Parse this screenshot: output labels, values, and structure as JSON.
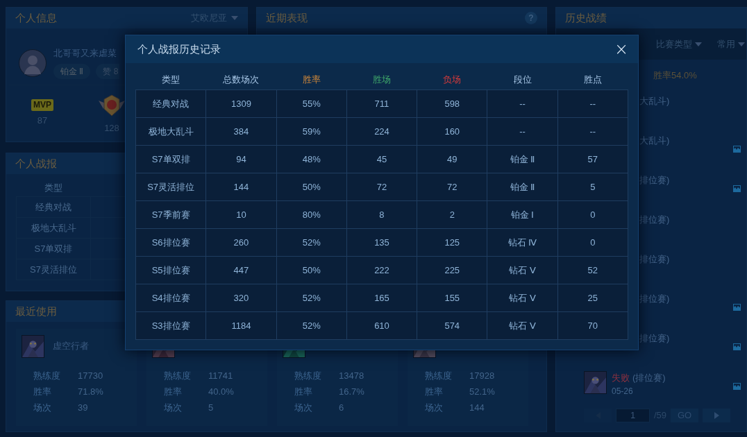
{
  "profile_panel": {
    "title": "个人信息",
    "server": "艾欧尼亚",
    "player_name": "北哥哥又来虐菜",
    "rank": "铂金 Ⅱ",
    "likes": "赞 8",
    "badges": [
      {
        "kind": "mvp",
        "label": "MVP",
        "count": "87"
      },
      {
        "kind": "medal",
        "count": "128"
      }
    ]
  },
  "stats_panel": {
    "title": "个人战报",
    "columns": [
      "类型"
    ],
    "rows": [
      [
        "经典对战"
      ],
      [
        "极地大乱斗"
      ],
      [
        "S7单双排"
      ],
      [
        "S7灵活排位"
      ]
    ]
  },
  "performance_panel": {
    "title": "近期表现",
    "help": "?"
  },
  "recent_panel": {
    "title": "最近使用",
    "heroes": [
      {
        "name": "虚空行者",
        "stats": [
          {
            "label": "熟练度",
            "value": "17730"
          },
          {
            "label": "胜率",
            "value": "71.8%"
          },
          {
            "label": "场次",
            "value": "39"
          }
        ]
      },
      {
        "stats": [
          {
            "label": "熟练度",
            "value": "11741"
          },
          {
            "label": "胜率",
            "value": "40.0%"
          },
          {
            "label": "场次",
            "value": "5"
          }
        ]
      },
      {
        "stats": [
          {
            "label": "熟练度",
            "value": "13478"
          },
          {
            "label": "胜率",
            "value": "16.7%"
          },
          {
            "label": "场次",
            "value": "6"
          }
        ]
      },
      {
        "stats": [
          {
            "label": "熟练度",
            "value": "17928"
          },
          {
            "label": "胜率",
            "value": "52.1%"
          },
          {
            "label": "场次",
            "value": "144"
          }
        ]
      }
    ]
  },
  "history_panel": {
    "title": "历史战绩",
    "filters": [
      "比赛类型",
      "常用"
    ],
    "win_rate": "胜率54.0%",
    "matches": [
      {
        "kind": "partial",
        "mode": "大乱斗)",
        "chart_icon": false
      },
      {
        "kind": "partial",
        "mode": "大乱斗)",
        "chart_icon": true
      },
      {
        "kind": "partial",
        "mode": "排位赛)",
        "chart_icon": true
      },
      {
        "kind": "partial",
        "mode": "排位赛)",
        "chart_icon": false
      },
      {
        "kind": "partial",
        "mode": "排位赛)",
        "chart_icon": false
      },
      {
        "kind": "partial",
        "mode": "排位赛)",
        "chart_icon": true
      },
      {
        "kind": "partial",
        "mode": "排位赛)",
        "chart_icon": true
      },
      {
        "kind": "full",
        "result": "失败",
        "mode": "(排位赛)",
        "date": "05-26",
        "chart_icon": true
      }
    ],
    "pagination": {
      "page": "1",
      "total": "/59",
      "go": "GO"
    }
  },
  "modal": {
    "title": "个人战报历史记录",
    "close": "×",
    "columns": [
      {
        "label": "类型",
        "kind": "plain"
      },
      {
        "label": "总数场次",
        "kind": "plain"
      },
      {
        "label": "胜率",
        "kind": "rate"
      },
      {
        "label": "胜场",
        "kind": "wins"
      },
      {
        "label": "负场",
        "kind": "losses"
      },
      {
        "label": "段位",
        "kind": "plain"
      },
      {
        "label": "胜点",
        "kind": "plain"
      }
    ],
    "rows": [
      [
        "经典对战",
        "1309",
        "55%",
        "711",
        "598",
        "--",
        "--"
      ],
      [
        "极地大乱斗",
        "384",
        "59%",
        "224",
        "160",
        "--",
        "--"
      ],
      [
        "S7单双排",
        "94",
        "48%",
        "45",
        "49",
        "铂金 Ⅱ",
        "57"
      ],
      [
        "S7灵活排位",
        "144",
        "50%",
        "72",
        "72",
        "铂金 Ⅱ",
        "5"
      ],
      [
        "S7季前赛",
        "10",
        "80%",
        "8",
        "2",
        "铂金 Ⅰ",
        "0"
      ],
      [
        "S6排位赛",
        "260",
        "52%",
        "135",
        "125",
        "钻石 Ⅳ",
        "0"
      ],
      [
        "S5排位赛",
        "447",
        "50%",
        "222",
        "225",
        "钻石 Ⅴ",
        "52"
      ],
      [
        "S4排位赛",
        "320",
        "52%",
        "165",
        "155",
        "钻石 Ⅴ",
        "25"
      ],
      [
        "S3排位赛",
        "1184",
        "52%",
        "610",
        "574",
        "钻石 Ⅴ",
        "70"
      ]
    ]
  }
}
